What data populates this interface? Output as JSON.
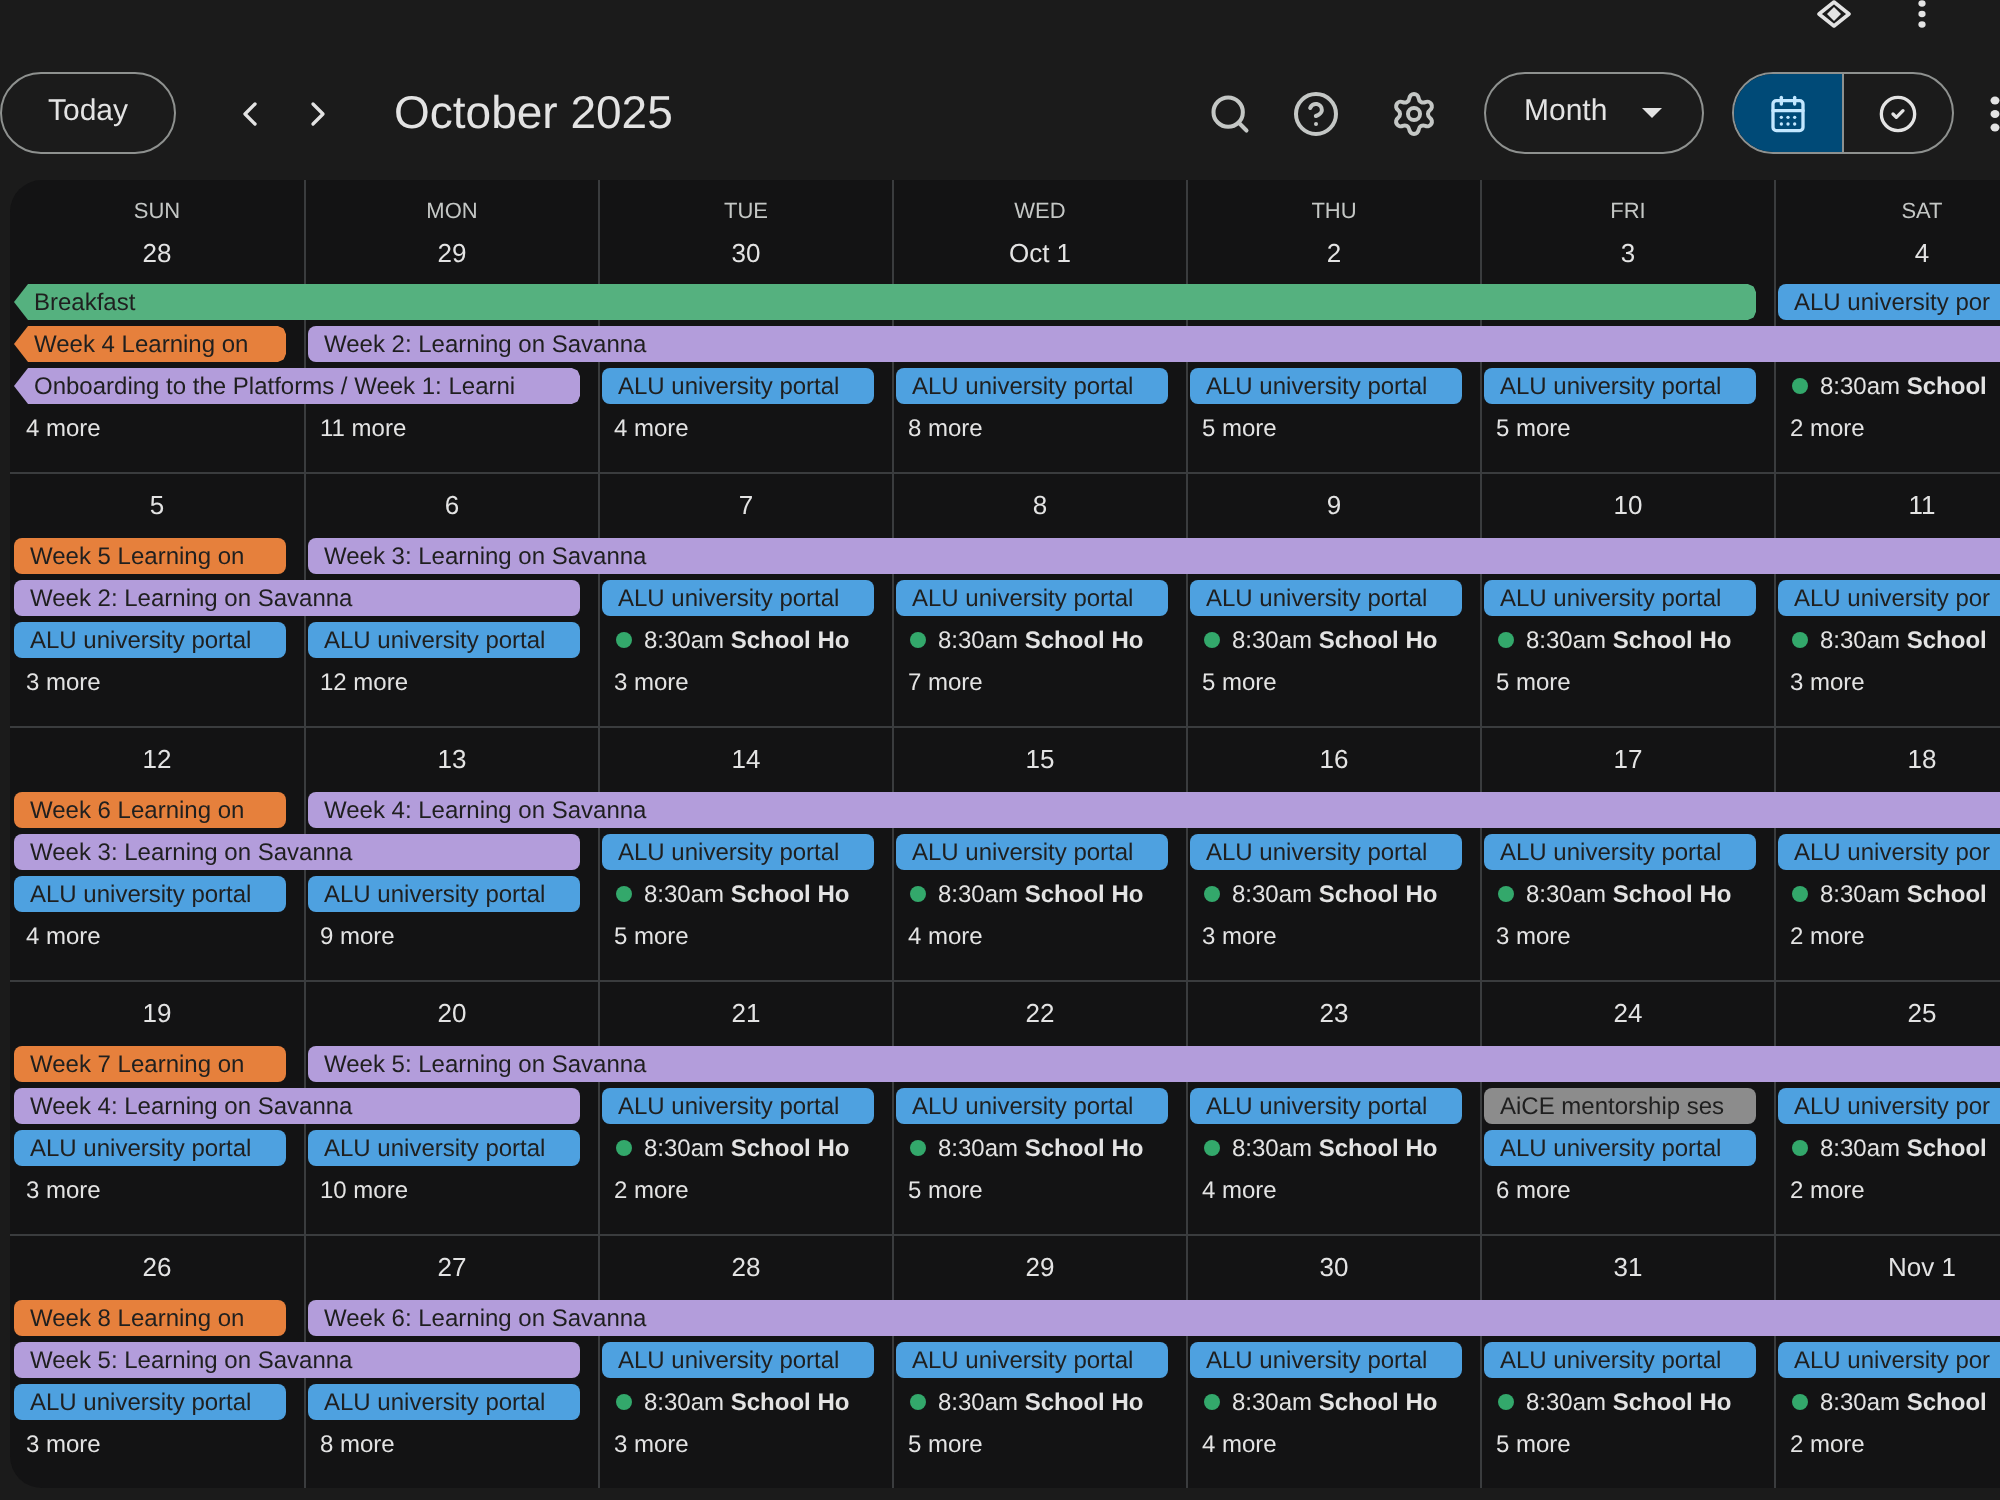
{
  "toolbar": {
    "today_button": "Today",
    "title": "October 2025",
    "view_menu": "Month",
    "view_switch": [
      {
        "kind": "calendar",
        "selected": true
      },
      {
        "kind": "tasks",
        "selected": false
      }
    ]
  },
  "calendar": {
    "weekdays": [
      "SUN",
      "MON",
      "TUE",
      "WED",
      "THU",
      "FRI",
      "SAT"
    ],
    "weeks": [
      {
        "dates": [
          "28",
          "29",
          "30",
          "Oct 1",
          "2",
          "3",
          "4"
        ],
        "lines": [
          [
            {
              "kind": "allday",
              "title": "Breakfast",
              "color": "#55b17f",
              "from_earlier": true
            },
            {
              "kind": "continued"
            },
            {
              "kind": "continued"
            },
            {
              "kind": "continued"
            },
            {
              "kind": "continued"
            },
            {
              "kind": "continued"
            },
            {
              "kind": "allday",
              "title": "ALU university por",
              "color": "#4ea1e0",
              "from_earlier": false
            }
          ],
          [
            {
              "kind": "allday",
              "title": "Week 4 Learning on",
              "color": "#e6803c",
              "from_earlier": true
            },
            {
              "kind": "allday",
              "title": "Week 2: Learning on Savanna",
              "color": "#b39ddb",
              "from_earlier": false
            },
            {
              "kind": "continued"
            },
            {
              "kind": "continued"
            },
            {
              "kind": "continued"
            },
            {
              "kind": "continued"
            },
            {
              "kind": "continued"
            }
          ],
          [
            {
              "kind": "allday",
              "title": "Onboarding to the Platforms / Week 1: Learni",
              "color": "#b39ddb",
              "from_earlier": true
            },
            {
              "kind": "continued"
            },
            {
              "kind": "allday",
              "title": "ALU university portal",
              "color": "#4ea1e0",
              "from_earlier": false
            },
            {
              "kind": "allday",
              "title": "ALU university portal",
              "color": "#4ea1e0",
              "from_earlier": false
            },
            {
              "kind": "allday",
              "title": "ALU university portal",
              "color": "#4ea1e0",
              "from_earlier": false
            },
            {
              "kind": "allday",
              "title": "ALU university portal",
              "color": "#4ea1e0",
              "from_earlier": false
            },
            {
              "kind": "timed",
              "time": "8:30am",
              "title": "School",
              "color": "#33a86b"
            }
          ]
        ],
        "more": [
          "4 more",
          "11 more",
          "4 more",
          "8 more",
          "5 more",
          "5 more",
          "2 more"
        ]
      },
      {
        "dates": [
          "5",
          "6",
          "7",
          "8",
          "9",
          "10",
          "11"
        ],
        "lines": [
          [
            {
              "kind": "allday",
              "title": "Week 5 Learning on",
              "color": "#e6803c",
              "from_earlier": false
            },
            {
              "kind": "allday",
              "title": "Week 3: Learning on Savanna",
              "color": "#b39ddb",
              "from_earlier": false
            },
            {
              "kind": "continued"
            },
            {
              "kind": "continued"
            },
            {
              "kind": "continued"
            },
            {
              "kind": "continued"
            },
            {
              "kind": "continued"
            }
          ],
          [
            {
              "kind": "allday",
              "title": "Week 2: Learning on Savanna",
              "color": "#b39ddb",
              "from_earlier": false
            },
            {
              "kind": "continued"
            },
            {
              "kind": "allday",
              "title": "ALU university portal",
              "color": "#4ea1e0",
              "from_earlier": false
            },
            {
              "kind": "allday",
              "title": "ALU university portal",
              "color": "#4ea1e0",
              "from_earlier": false
            },
            {
              "kind": "allday",
              "title": "ALU university portal",
              "color": "#4ea1e0",
              "from_earlier": false
            },
            {
              "kind": "allday",
              "title": "ALU university portal",
              "color": "#4ea1e0",
              "from_earlier": false
            },
            {
              "kind": "allday",
              "title": "ALU university por",
              "color": "#4ea1e0",
              "from_earlier": false
            }
          ],
          [
            {
              "kind": "allday",
              "title": "ALU university portal",
              "color": "#4ea1e0",
              "from_earlier": false
            },
            {
              "kind": "allday",
              "title": "ALU university portal",
              "color": "#4ea1e0",
              "from_earlier": false
            },
            {
              "kind": "timed",
              "time": "8:30am",
              "title": "School Ho",
              "color": "#33a86b"
            },
            {
              "kind": "timed",
              "time": "8:30am",
              "title": "School Ho",
              "color": "#33a86b"
            },
            {
              "kind": "timed",
              "time": "8:30am",
              "title": "School Ho",
              "color": "#33a86b"
            },
            {
              "kind": "timed",
              "time": "8:30am",
              "title": "School Ho",
              "color": "#33a86b"
            },
            {
              "kind": "timed",
              "time": "8:30am",
              "title": "School",
              "color": "#33a86b"
            }
          ]
        ],
        "more": [
          "3 more",
          "12 more",
          "3 more",
          "7 more",
          "5 more",
          "5 more",
          "3 more"
        ]
      },
      {
        "dates": [
          "12",
          "13",
          "14",
          "15",
          "16",
          "17",
          "18"
        ],
        "lines": [
          [
            {
              "kind": "allday",
              "title": "Week 6 Learning on",
              "color": "#e6803c",
              "from_earlier": false
            },
            {
              "kind": "allday",
              "title": "Week 4: Learning on Savanna",
              "color": "#b39ddb",
              "from_earlier": false
            },
            {
              "kind": "continued"
            },
            {
              "kind": "continued"
            },
            {
              "kind": "continued"
            },
            {
              "kind": "continued"
            },
            {
              "kind": "continued"
            }
          ],
          [
            {
              "kind": "allday",
              "title": "Week 3: Learning on Savanna",
              "color": "#b39ddb",
              "from_earlier": false
            },
            {
              "kind": "continued"
            },
            {
              "kind": "allday",
              "title": "ALU university portal",
              "color": "#4ea1e0",
              "from_earlier": false
            },
            {
              "kind": "allday",
              "title": "ALU university portal",
              "color": "#4ea1e0",
              "from_earlier": false
            },
            {
              "kind": "allday",
              "title": "ALU university portal",
              "color": "#4ea1e0",
              "from_earlier": false
            },
            {
              "kind": "allday",
              "title": "ALU university portal",
              "color": "#4ea1e0",
              "from_earlier": false
            },
            {
              "kind": "allday",
              "title": "ALU university por",
              "color": "#4ea1e0",
              "from_earlier": false
            }
          ],
          [
            {
              "kind": "allday",
              "title": "ALU university portal",
              "color": "#4ea1e0",
              "from_earlier": false
            },
            {
              "kind": "allday",
              "title": "ALU university portal",
              "color": "#4ea1e0",
              "from_earlier": false
            },
            {
              "kind": "timed",
              "time": "8:30am",
              "title": "School Ho",
              "color": "#33a86b"
            },
            {
              "kind": "timed",
              "time": "8:30am",
              "title": "School Ho",
              "color": "#33a86b"
            },
            {
              "kind": "timed",
              "time": "8:30am",
              "title": "School Ho",
              "color": "#33a86b"
            },
            {
              "kind": "timed",
              "time": "8:30am",
              "title": "School Ho",
              "color": "#33a86b"
            },
            {
              "kind": "timed",
              "time": "8:30am",
              "title": "School",
              "color": "#33a86b"
            }
          ]
        ],
        "more": [
          "4 more",
          "9 more",
          "5 more",
          "4 more",
          "3 more",
          "3 more",
          "2 more"
        ]
      },
      {
        "dates": [
          "19",
          "20",
          "21",
          "22",
          "23",
          "24",
          "25"
        ],
        "lines": [
          [
            {
              "kind": "allday",
              "title": "Week 7 Learning on",
              "color": "#e6803c",
              "from_earlier": false
            },
            {
              "kind": "allday",
              "title": "Week 5: Learning on Savanna",
              "color": "#b39ddb",
              "from_earlier": false
            },
            {
              "kind": "continued"
            },
            {
              "kind": "continued"
            },
            {
              "kind": "continued"
            },
            {
              "kind": "continued"
            },
            {
              "kind": "continued"
            }
          ],
          [
            {
              "kind": "allday",
              "title": "Week 4: Learning on Savanna",
              "color": "#b39ddb",
              "from_earlier": false
            },
            {
              "kind": "continued"
            },
            {
              "kind": "allday",
              "title": "ALU university portal",
              "color": "#4ea1e0",
              "from_earlier": false
            },
            {
              "kind": "allday",
              "title": "ALU university portal",
              "color": "#4ea1e0",
              "from_earlier": false
            },
            {
              "kind": "allday",
              "title": "ALU university portal",
              "color": "#4ea1e0",
              "from_earlier": false
            },
            {
              "kind": "allday",
              "title": "AiCE mentorship ses",
              "color": "#8c8c8c",
              "from_earlier": false
            },
            {
              "kind": "allday",
              "title": "ALU university por",
              "color": "#4ea1e0",
              "from_earlier": false
            }
          ],
          [
            {
              "kind": "allday",
              "title": "ALU university portal",
              "color": "#4ea1e0",
              "from_earlier": false
            },
            {
              "kind": "allday",
              "title": "ALU university portal",
              "color": "#4ea1e0",
              "from_earlier": false
            },
            {
              "kind": "timed",
              "time": "8:30am",
              "title": "School Ho",
              "color": "#33a86b"
            },
            {
              "kind": "timed",
              "time": "8:30am",
              "title": "School Ho",
              "color": "#33a86b"
            },
            {
              "kind": "timed",
              "time": "8:30am",
              "title": "School Ho",
              "color": "#33a86b"
            },
            {
              "kind": "allday",
              "title": "ALU university portal",
              "color": "#4ea1e0",
              "from_earlier": false
            },
            {
              "kind": "timed",
              "time": "8:30am",
              "title": "School",
              "color": "#33a86b"
            }
          ]
        ],
        "more": [
          "3 more",
          "10 more",
          "2 more",
          "5 more",
          "4 more",
          "6 more",
          "2 more"
        ]
      },
      {
        "dates": [
          "26",
          "27",
          "28",
          "29",
          "30",
          "31",
          "Nov 1"
        ],
        "lines": [
          [
            {
              "kind": "allday",
              "title": "Week 8 Learning on",
              "color": "#e6803c",
              "from_earlier": false
            },
            {
              "kind": "allday",
              "title": "Week 6: Learning on Savanna",
              "color": "#b39ddb",
              "from_earlier": false
            },
            {
              "kind": "continued"
            },
            {
              "kind": "continued"
            },
            {
              "kind": "continued"
            },
            {
              "kind": "continued"
            },
            {
              "kind": "continued"
            }
          ],
          [
            {
              "kind": "allday",
              "title": "Week 5: Learning on Savanna",
              "color": "#b39ddb",
              "from_earlier": false
            },
            {
              "kind": "continued"
            },
            {
              "kind": "allday",
              "title": "ALU university portal",
              "color": "#4ea1e0",
              "from_earlier": false
            },
            {
              "kind": "allday",
              "title": "ALU university portal",
              "color": "#4ea1e0",
              "from_earlier": false
            },
            {
              "kind": "allday",
              "title": "ALU university portal",
              "color": "#4ea1e0",
              "from_earlier": false
            },
            {
              "kind": "allday",
              "title": "ALU university portal",
              "color": "#4ea1e0",
              "from_earlier": false
            },
            {
              "kind": "allday",
              "title": "ALU university por",
              "color": "#4ea1e0",
              "from_earlier": false
            }
          ],
          [
            {
              "kind": "allday",
              "title": "ALU university portal",
              "color": "#4ea1e0",
              "from_earlier": false
            },
            {
              "kind": "allday",
              "title": "ALU university portal",
              "color": "#4ea1e0",
              "from_earlier": false
            },
            {
              "kind": "timed",
              "time": "8:30am",
              "title": "School Ho",
              "color": "#33a86b"
            },
            {
              "kind": "timed",
              "time": "8:30am",
              "title": "School Ho",
              "color": "#33a86b"
            },
            {
              "kind": "timed",
              "time": "8:30am",
              "title": "School Ho",
              "color": "#33a86b"
            },
            {
              "kind": "timed",
              "time": "8:30am",
              "title": "School Ho",
              "color": "#33a86b"
            },
            {
              "kind": "timed",
              "time": "8:30am",
              "title": "School",
              "color": "#33a86b"
            }
          ]
        ],
        "more": [
          "3 more",
          "8 more",
          "3 more",
          "5 more",
          "4 more",
          "5 more",
          "2 more"
        ]
      }
    ]
  }
}
